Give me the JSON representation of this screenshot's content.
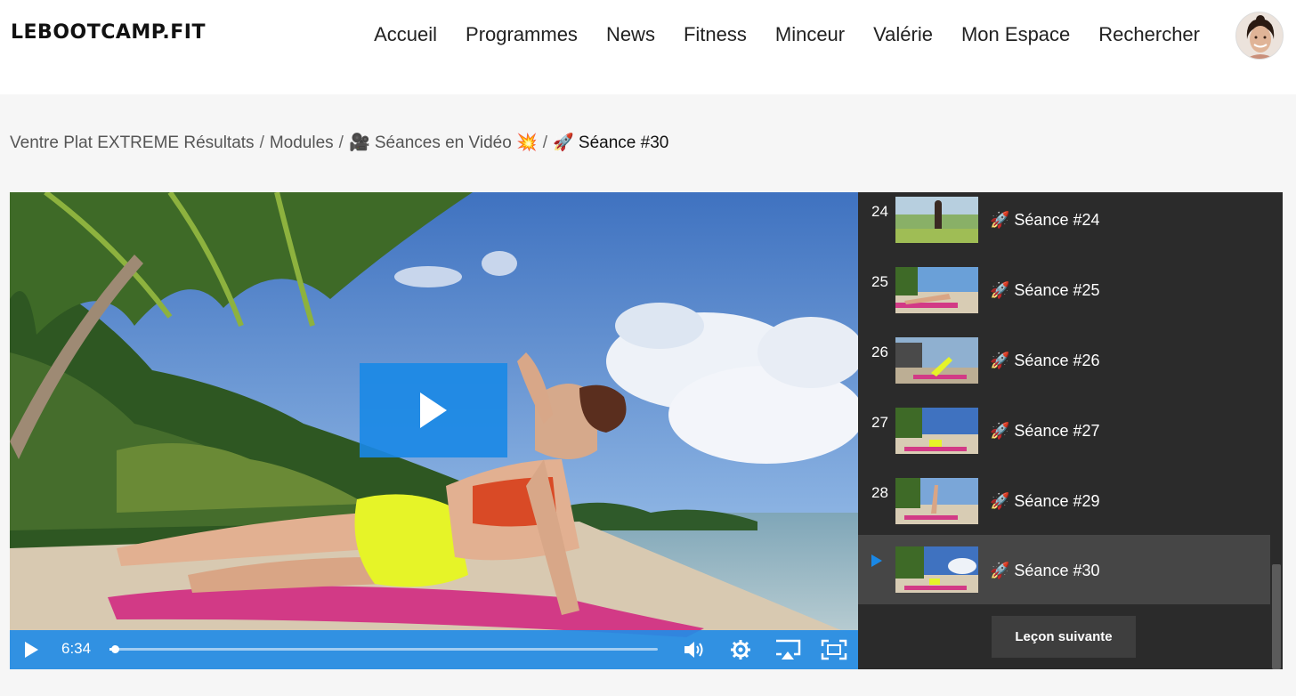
{
  "site": {
    "logo": "LEBOOTCAMP.FIT"
  },
  "nav": {
    "items": [
      "Accueil",
      "Programmes",
      "News",
      "Fitness",
      "Minceur",
      "Valérie",
      "Mon Espace",
      "Rechercher"
    ]
  },
  "breadcrumb": {
    "course": "Ventre Plat EXTREME Résultats",
    "module": "Modules",
    "section": "🎥 Séances en Vidéo 💥",
    "current": "🚀 Séance #30",
    "separator": "/"
  },
  "video": {
    "time": "6:34",
    "progress_fraction": 0.01
  },
  "playlist": {
    "items": [
      {
        "num": "24",
        "title": "🚀 Séance #24",
        "active": false
      },
      {
        "num": "25",
        "title": "🚀 Séance #25",
        "active": false
      },
      {
        "num": "26",
        "title": "🚀 Séance #26",
        "active": false
      },
      {
        "num": "27",
        "title": "🚀 Séance #27",
        "active": false
      },
      {
        "num": "28",
        "title": "🚀 Séance #29",
        "active": false
      },
      {
        "num": "",
        "title": "🚀 Séance #30",
        "active": true
      }
    ],
    "next_label": "Leçon suivante"
  },
  "colors": {
    "accent": "#1a88e6",
    "playlist_bg": "#2b2b2b",
    "playlist_active_bg": "#464646"
  }
}
